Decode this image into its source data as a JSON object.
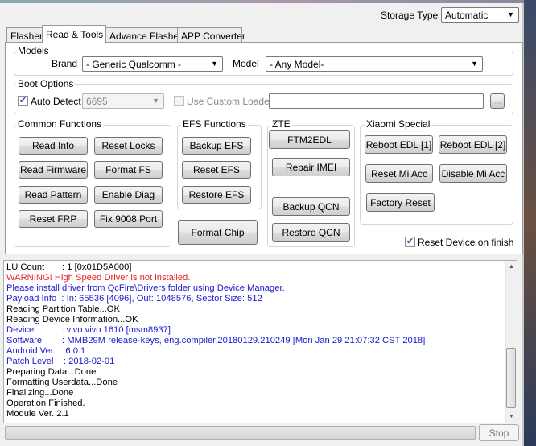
{
  "header": {
    "storage_type_label": "Storage Type",
    "storage_type_value": "Automatic"
  },
  "tabs": [
    {
      "label": "Flasher"
    },
    {
      "label": "Read & Tools",
      "active": true
    },
    {
      "label": "Advance Flasher"
    },
    {
      "label": "APP Converter"
    }
  ],
  "models": {
    "title": "Models",
    "brand_label": "Brand",
    "brand_value": "- Generic Qualcomm -",
    "model_label": "Model",
    "model_value": "- Any Model-"
  },
  "boot": {
    "title": "Boot Options",
    "auto_detect_label": "Auto Detect",
    "auto_detect_checked": true,
    "port_value": "6695",
    "custom_loader_label": "Use Custom Loader",
    "custom_loader_checked": false,
    "loader_path": "",
    "browse_label": "..."
  },
  "common": {
    "title": "Common Functions",
    "buttons": [
      "Read Info",
      "Reset Locks",
      "Read Firmware",
      "Format FS",
      "Read Pattern",
      "Enable Diag",
      "Reset FRP",
      "Fix 9008 Port"
    ]
  },
  "efs": {
    "title": "EFS Functions",
    "buttons": [
      "Backup EFS",
      "Reset EFS",
      "Restore EFS"
    ],
    "format_chip": "Format Chip"
  },
  "zte": {
    "title": "ZTE",
    "buttons": [
      "FTM2EDL",
      "Repair IMEI",
      "Backup QCN",
      "Restore QCN"
    ]
  },
  "xiaomi": {
    "title": "Xiaomi Special",
    "buttons": [
      "Reboot EDL [1]",
      "Reboot EDL [2]",
      "Reset Mi Acc",
      "Disable Mi Acc",
      "Factory Reset"
    ]
  },
  "reset_on_finish": {
    "label": "Reset Device on finish",
    "checked": true
  },
  "log": [
    {
      "text": "LU Count       : 1 [0x01D5A000]",
      "color": "#000000"
    },
    {
      "text": "WARNING! High Speed Driver is not installed.",
      "color": "#e8202a"
    },
    {
      "text": "Please install driver from QcFire\\Drivers folder using Device Manager.",
      "color": "#1a1ad0"
    },
    {
      "text": "Payload Info  : In: 65536 [4096], Out: 1048576, Sector Size: 512",
      "color": "#1a1ad0"
    },
    {
      "text": "Reading Partition Table...OK",
      "color": "#000000"
    },
    {
      "text": "Reading Device Information...OK",
      "color": "#000000"
    },
    {
      "text": "Device           : vivo vivo 1610 [msm8937]",
      "color": "#1a1ad0"
    },
    {
      "text": "Software        : MMB29M release-keys, eng.compiler.20180129.210249 [Mon Jan 29 21:07:32 CST 2018]",
      "color": "#1a1ad0"
    },
    {
      "text": "Android Ver.  : 6.0.1",
      "color": "#1a1ad0"
    },
    {
      "text": "Patch Level    : 2018-02-01",
      "color": "#1a1ad0"
    },
    {
      "text": "Preparing Data...Done",
      "color": "#000000"
    },
    {
      "text": "Formatting Userdata...Done",
      "color": "#000000"
    },
    {
      "text": "Finalizing...Done",
      "color": "#000000"
    },
    {
      "text": "Operation Finished.",
      "color": "#000000"
    },
    {
      "text": "Module Ver. 2.1",
      "color": "#000000"
    }
  ],
  "footer": {
    "progress_percent": 0,
    "stop_label": "Stop"
  }
}
